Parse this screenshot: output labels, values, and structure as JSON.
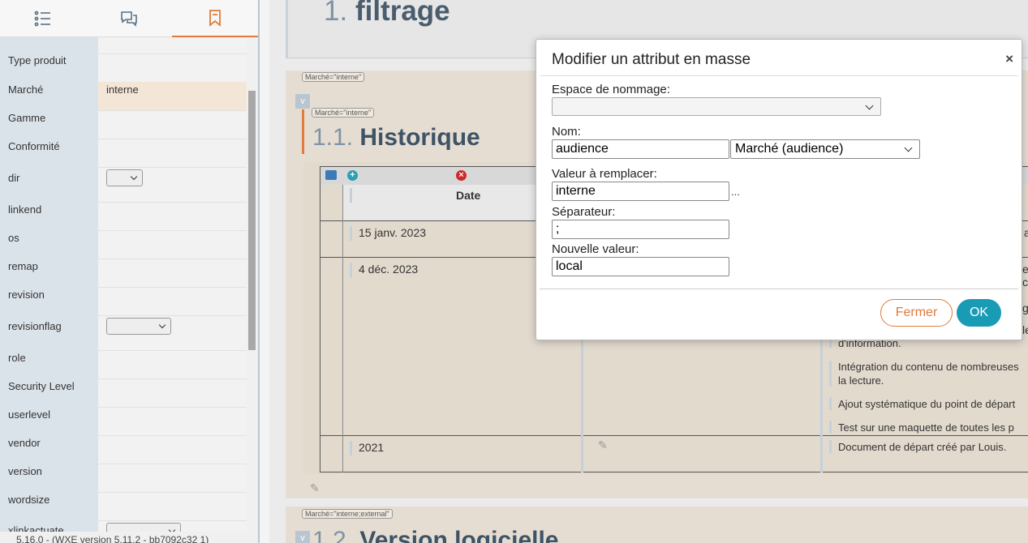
{
  "left_panel": {
    "tabs": [
      {
        "name": "list-icon"
      },
      {
        "name": "comments-icon"
      },
      {
        "name": "bookmark-icon",
        "active": true
      }
    ],
    "properties": [
      {
        "name": "Type produit",
        "value": ""
      },
      {
        "name": "Marché",
        "value": "interne"
      },
      {
        "name": "Gamme",
        "value": ""
      },
      {
        "name": "Conformité",
        "value": ""
      },
      {
        "name": "dir",
        "value": ""
      },
      {
        "name": "linkend",
        "value": ""
      },
      {
        "name": "os",
        "value": ""
      },
      {
        "name": "remap",
        "value": ""
      },
      {
        "name": "revision",
        "value": ""
      },
      {
        "name": "revisionflag",
        "value": ""
      },
      {
        "name": "role",
        "value": ""
      },
      {
        "name": "Security Level",
        "value": ""
      },
      {
        "name": "userlevel",
        "value": ""
      },
      {
        "name": "vendor",
        "value": ""
      },
      {
        "name": "version",
        "value": ""
      },
      {
        "name": "wordsize",
        "value": ""
      },
      {
        "name": "xlinkactuate",
        "value": ""
      }
    ],
    "status_text": "5.16.0 - (WXE version 5.11.2 - bb7092c32 1)"
  },
  "document": {
    "section1": {
      "number": "1.",
      "title": "filtrage"
    },
    "section1_1": {
      "tag": "Marché=\"interne\"",
      "inner_tag": "Marché=\"interne\"",
      "number": "1.1.",
      "title": "Historique"
    },
    "table": {
      "header_date": "Date",
      "rows": [
        {
          "date": "15 janv. 2023",
          "right": "a"
        },
        {
          "date": "4 déc. 2023",
          "right_lines": [
            "en",
            "co",
            "g",
            "le",
            "d'information.",
            "Intégration du contenu de nombreuses",
            "la lecture.",
            "Ajout systématique du point de départ",
            "Test sur une maquette de toutes les p"
          ]
        },
        {
          "date": "2021",
          "right": "Document de départ créé par Louis."
        }
      ]
    },
    "section1_2": {
      "tag": "Marché=\"interne;external\"",
      "number": "1.2.",
      "title": "Version logicielle"
    }
  },
  "dialog": {
    "title": "Modifier un attribut en masse",
    "close": "×",
    "namespace_label": "Espace de nommage:",
    "namespace_value": "",
    "nom_label": "Nom:",
    "nom_value": "audience",
    "nom_select": "Marché (audience)",
    "replace_label": "Valeur à remplacer:",
    "replace_value": "interne",
    "replace_more": "...",
    "separator_label": "Séparateur:",
    "separator_value": ";",
    "new_label": "Nouvelle valeur:",
    "new_value": "local",
    "btn_close": "Fermer",
    "btn_ok": "OK"
  },
  "colors": {
    "accent_orange": "#e07b39",
    "ok_blue": "#1a9bb5",
    "heading": "#3e5366"
  }
}
